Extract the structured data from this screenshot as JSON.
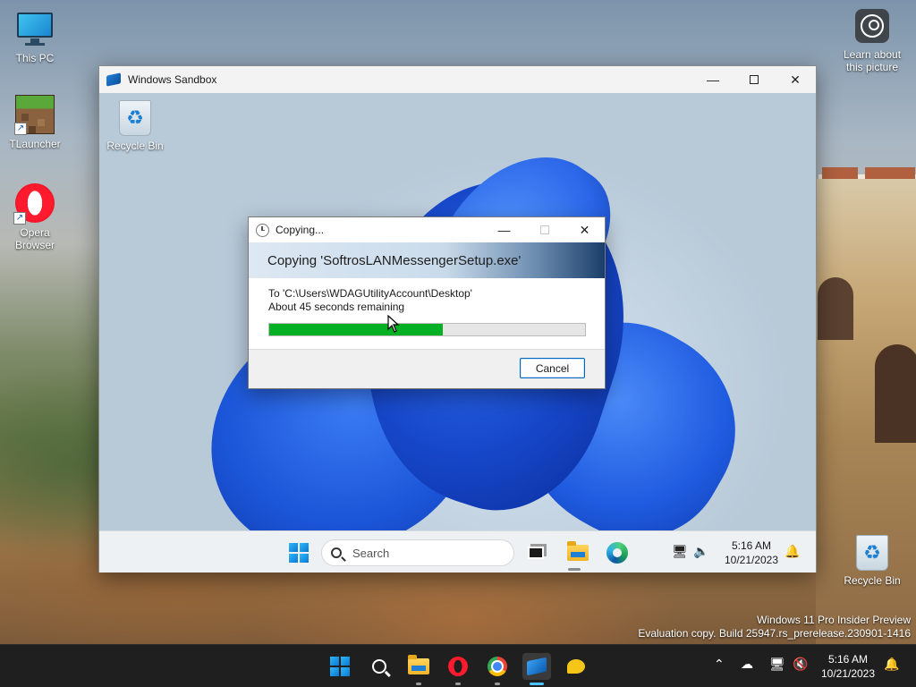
{
  "host_desktop": {
    "icons": [
      {
        "label": "This PC",
        "icon": "monitor-icon"
      },
      {
        "label": "TLauncher",
        "icon": "minecraft-grass-block-icon"
      },
      {
        "label": "Opera Browser",
        "icon": "opera-icon"
      },
      {
        "label": "Recycle Bin",
        "icon": "recycle-bin-icon"
      }
    ],
    "learn_about": {
      "label": "Learn about this picture",
      "icon": "camera-info-icon"
    },
    "watermark": {
      "line1": "Windows 11 Pro Insider Preview",
      "line2": "Evaluation copy. Build 25947.rs_prerelease.230901-1416"
    }
  },
  "sandbox_window": {
    "title": "Windows Sandbox",
    "desktop_icons": [
      {
        "label": "Recycle Bin",
        "icon": "recycle-bin-icon"
      }
    ],
    "taskbar": {
      "search_placeholder": "Search",
      "time": "5:16 AM",
      "date": "10/21/2023",
      "apps": [
        "start",
        "task-view",
        "file-explorer",
        "edge"
      ]
    }
  },
  "copy_dialog": {
    "title": "Copying...",
    "header": "Copying 'SoftrosLANMessengerSetup.exe'",
    "destination": "To 'C:\\Users\\WDAGUtilityAccount\\Desktop'",
    "remaining": "About 45 seconds remaining",
    "progress_fraction": 0.55,
    "progress_color": "#06b025",
    "cancel_label": "Cancel"
  },
  "host_taskbar": {
    "time": "5:16 AM",
    "date": "10/21/2023",
    "apps": [
      "start",
      "search",
      "file-explorer",
      "opera",
      "chrome",
      "windows-sandbox",
      "feedback"
    ],
    "accent": "#4cc2ff"
  }
}
